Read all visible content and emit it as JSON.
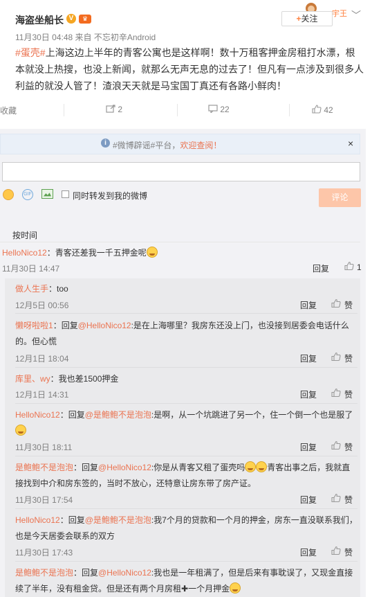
{
  "post": {
    "author": "海盗坐船长",
    "meta": "11月30日 04:48 来自 不忘初辛Android",
    "follow_label": "关注",
    "follow_plus": "+",
    "deco_text": "宇王",
    "hashtag": "#蛋壳#",
    "text": "上海这边上半年的青客公寓也是这样啊！数十万租客押金房租打水漂，根本就没上热搜，也没上新闻，就那么无声无息的过去了！但凡有一点涉及到很多人利益的就没人管了！渣浪天天就是马宝国丁真还有各路小鲜肉！"
  },
  "actions": {
    "favorite": "收藏",
    "repost_count": "2",
    "comment_count": "22",
    "like_count": "42"
  },
  "tip": {
    "text_before": "#微博辟谣#平台，",
    "text_link": "欢迎查阅！",
    "close": "×"
  },
  "compose": {
    "placeholder": "",
    "repost_label": "同时转发到我的微博",
    "submit_label": "评论"
  },
  "sort_label": "按时间",
  "main_comment": {
    "user": "HelloNico12",
    "text": "：青客还差我一千五押金呢",
    "time": "11月30日 14:47",
    "reply": "回复",
    "likes": "1"
  },
  "sub_comments": [
    {
      "user": "做人生手",
      "text": "：too",
      "time": "12月5日 00:56"
    },
    {
      "user": "懒呀啦啦1",
      "pre": "：回复",
      "mention": "@HelloNico12",
      "text": ":是在上海哪里？我房东还没上门，也没接到居委会电话什么的。但心慌",
      "time": "12月1日 18:04"
    },
    {
      "user": "库里、wy",
      "text": "：我也差1500押金",
      "time": "12月1日 14:31"
    },
    {
      "user": "HelloNico12",
      "pre": "：回复",
      "mention": "@是鲍鲍不是泡泡",
      "text": ":是啊，从一个坑跳进了另一个，住一个倒一个也是服了",
      "time": "11月30日 18:11"
    },
    {
      "user": "是鲍鲍不是泡泡",
      "pre": "：回复",
      "mention": "@HelloNico12",
      "text": ":你是从青客又租了蛋壳吗",
      "text2": "青客出事之后，我就直接找到中介和房东签的，当时不放心，还特意让房东带了房产证。",
      "time": "11月30日 17:54"
    },
    {
      "user": "HelloNico12",
      "pre": "：回复",
      "mention": "@是鲍鲍不是泡泡",
      "text": ":我7个月的贷款和一个月的押金，房东一直没联系我们，也是今天居委会联系的双方",
      "time": "11月30日 17:43"
    },
    {
      "user": "是鲍鲍不是泡泡",
      "pre": "：回复",
      "mention": "@HelloNico12",
      "text": ":我也是一年租满了，但是后来有事耽误了，又现金直接续了半年，没有租金贷。但是还有两个月房租",
      "plus": "✚",
      "text3": "一个月押金"
    }
  ],
  "sub_reply_label": "回复",
  "sub_like_label": "赞"
}
